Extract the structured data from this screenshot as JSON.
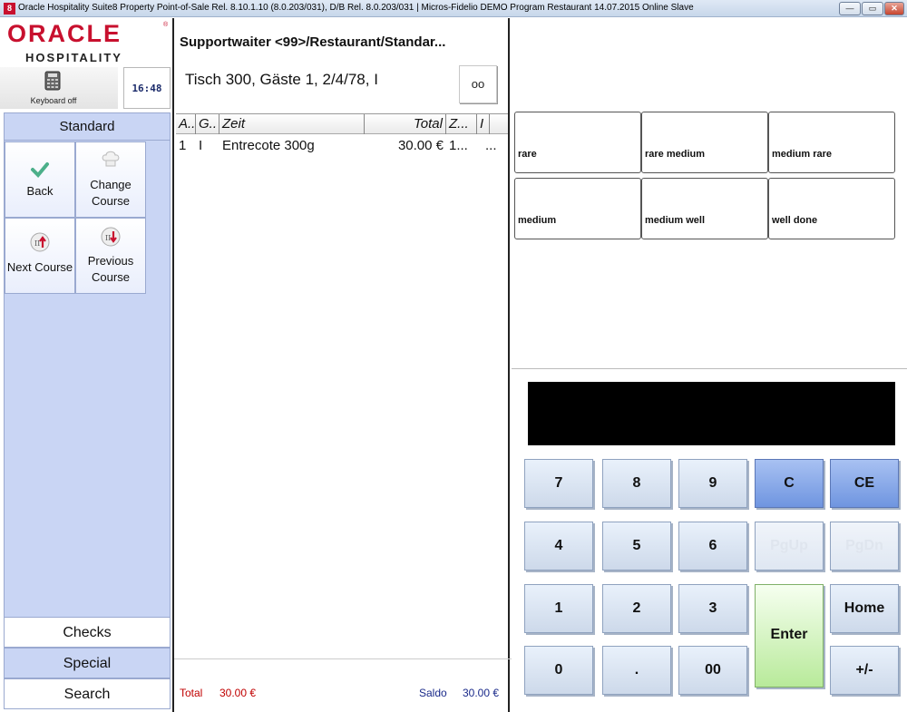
{
  "window": {
    "app_icon": "8",
    "title": "Oracle Hospitality Suite8 Property Point-of-Sale Rel. 8.10.1.10 (8.0.203/031), D/B Rel. 8.0.203/031 | Micros-Fidelio DEMO Program Restaurant 14.07.2015 Online Slave",
    "minimize": "—",
    "maximize": "▭",
    "close": "✕"
  },
  "brand": {
    "oracle": "ORACLE",
    "registered": "®",
    "hospitality": "HOSPITALITY"
  },
  "status": {
    "keyboard_label": "Keyboard off",
    "clock": "16:48"
  },
  "menu": {
    "header": "Standard",
    "buttons": [
      {
        "line1": "Back",
        "line2": ""
      },
      {
        "line1": "Change",
        "line2": "Course"
      },
      {
        "line1": "Next Course",
        "line2": ""
      },
      {
        "line1": "Previous",
        "line2": "Course"
      }
    ]
  },
  "tabs": {
    "checks": "Checks",
    "special": "Special",
    "search": "Search"
  },
  "order": {
    "title": "Supportwaiter <99>/Restaurant/Standar...",
    "table_info": "Tisch 300, Gäste 1, 2/4/78, I",
    "glasses_icon": "glasses-icon",
    "glasses_glyph": "oo",
    "columns": [
      "A..",
      "G..",
      "Zeit",
      "Total",
      "Z...",
      "I"
    ],
    "rows": [
      {
        "a": "1",
        "g": "I",
        "item": "Entrecote 300g",
        "total": "30.00 €",
        "z": "1...",
        "extra": "..."
      }
    ],
    "total_label": "Total",
    "total_value": "30.00 €",
    "saldo_label": "Saldo",
    "saldo_value": "30.00 €"
  },
  "modifiers": [
    "rare",
    "rare medium",
    "medium rare",
    "medium",
    "medium well",
    "well done"
  ],
  "keypad": {
    "k7": "7",
    "k8": "8",
    "k9": "9",
    "kC": "C",
    "kCE": "CE",
    "k4": "4",
    "k5": "5",
    "k6": "6",
    "kPgUp": "PgUp",
    "kPgDn": "PgDn",
    "k1": "1",
    "k2": "2",
    "k3": "3",
    "kEnter": "Enter",
    "kHome": "Home",
    "k0": "0",
    "kDot": ".",
    "k00": "00",
    "kSign": "+/-"
  },
  "colors": {
    "brand_red": "#c8102e",
    "menu_blue": "#c9d5f4",
    "total_red": "#c00000",
    "saldo_blue": "#1a2a8a",
    "enter_green": "#b8ea9a"
  }
}
